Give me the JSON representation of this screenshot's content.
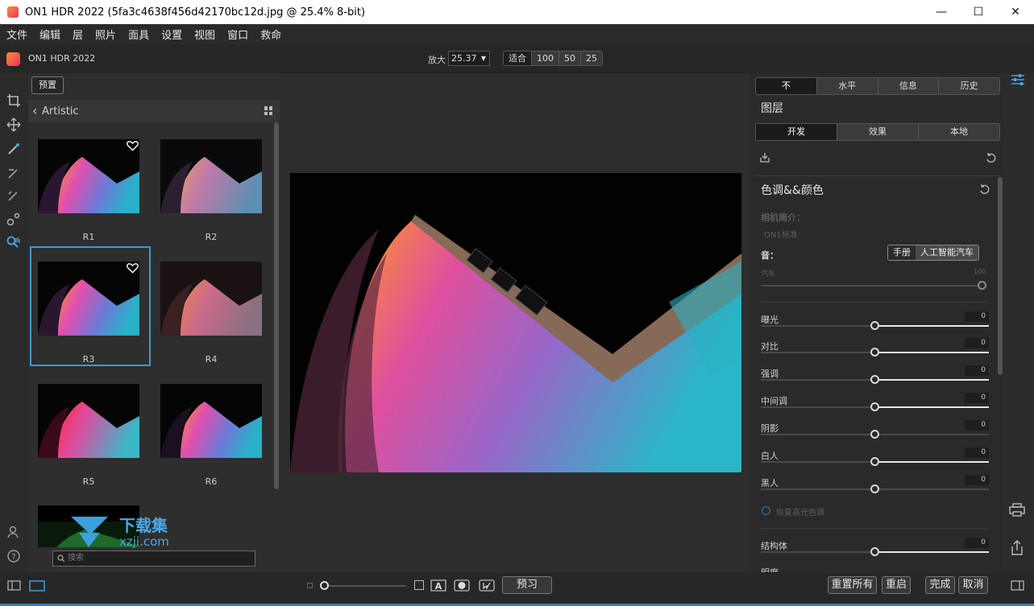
{
  "window": {
    "title": "ON1 HDR 2022 (5fa3c4638f456d42170bc12d.jpg @ 25.4% 8-bit)",
    "minimize": "—",
    "maximize": "☐",
    "close": "✕"
  },
  "menu": [
    "文件",
    "编辑",
    "层",
    "照片",
    "面具",
    "设置",
    "视图",
    "窗口",
    "救命"
  ],
  "appbar": {
    "app_name": "ON1 HDR 2022",
    "zoom_label": "放大",
    "zoom_value": "25.37",
    "zoom_presets": [
      "适合",
      "100",
      "50",
      "25"
    ]
  },
  "presets": {
    "button": "预置",
    "category": "Artistic",
    "items": [
      {
        "label": "R1",
        "favorite": true
      },
      {
        "label": "R2",
        "favorite": false
      },
      {
        "label": "R3",
        "favorite": true,
        "selected": true
      },
      {
        "label": "R4",
        "favorite": false
      },
      {
        "label": "R5",
        "favorite": false
      },
      {
        "label": "R6",
        "favorite": false
      }
    ],
    "search_placeholder": "搜索"
  },
  "watermark": {
    "text1": "下载集",
    "text2": "xzji.com"
  },
  "right_panel": {
    "top_tabs": [
      "不",
      "水平",
      "信息",
      "历史"
    ],
    "layers_title": "图层",
    "sub_tabs": [
      "开发",
      "效果",
      "本地"
    ],
    "section_title": "色调&&颜色",
    "camera_profile_label": "相机简介：",
    "camera_profile_value": "ON1标准",
    "tone_label": "音：",
    "tone_modes": [
      "手册",
      "人工智能汽车"
    ],
    "auto_label": "汽车",
    "auto_value": "100",
    "sliders": [
      {
        "label": "曝光",
        "value": "0"
      },
      {
        "label": "对比",
        "value": "0"
      },
      {
        "label": "强调",
        "value": "0"
      },
      {
        "label": "中间调",
        "value": "0"
      },
      {
        "label": "阴影",
        "value": "0"
      },
      {
        "label": "白人",
        "value": "0"
      },
      {
        "label": "黑人",
        "value": "0"
      }
    ],
    "highlight_option": "恢复高光色调",
    "structure": {
      "label": "结构体",
      "value": "0"
    },
    "clarity_label": "明度"
  },
  "bottom": {
    "preview": "预习",
    "reset_all": "重置所有",
    "restart": "重启",
    "done": "完成",
    "cancel": "取消"
  },
  "colors": {
    "accent": "#3a9ad9",
    "bottom_border": "#2d7fc7"
  }
}
